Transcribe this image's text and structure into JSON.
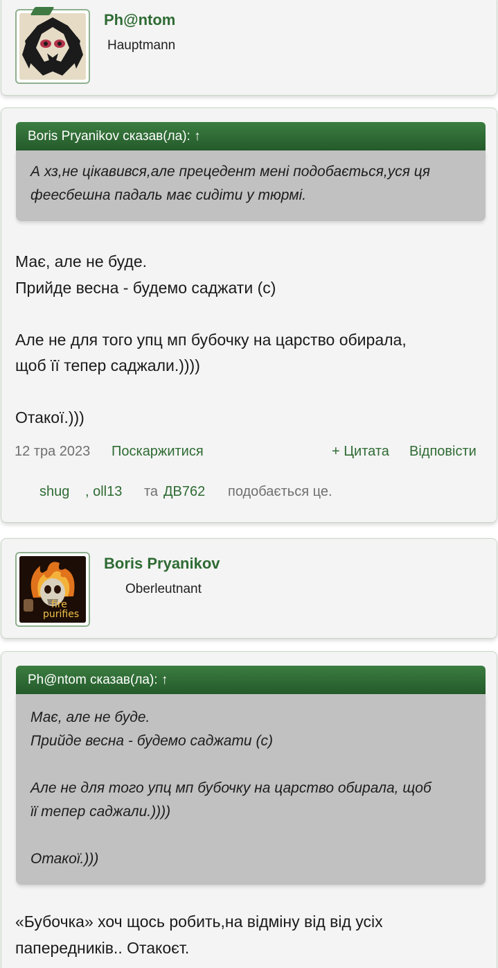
{
  "post1_user": {
    "name": "Ph@ntom",
    "rank": "Hauptmann",
    "avatar_icon": "tribal-mask-avatar"
  },
  "post1": {
    "quote_header": "Boris Pryanikov сказав(ла): ↑",
    "quote_lines": [
      "А хз,не цікавився,але прецедент мені подобається,уся ця",
      "феесбешна падаль має сидіти у тюрмі."
    ],
    "message_lines": [
      "Має, але не буде.",
      "Прийде весна - будемо саджати (с)",
      "",
      "Але не для того упц мп бубочку на царство обирала,",
      "щоб її тепер саджали.))))",
      "",
      "Отакої.)))"
    ],
    "date": "12 тра 2023",
    "report_label": "Поскаржитися",
    "quote_label": "+ Цитата",
    "reply_label": "Відповісти",
    "likes": {
      "user1": "shug",
      "user2": ", oll13",
      "and": "та",
      "user3": "ДВ762",
      "suffix": "подобається це."
    }
  },
  "post2_user": {
    "name": "Boris Pryanikov",
    "rank": "Oberleutnant",
    "avatar_icon": "flaming-skull-avatar",
    "avatar_caption_1": "fire",
    "avatar_caption_2": "purifies"
  },
  "post2": {
    "quote_header": "Ph@ntom сказав(ла): ↑",
    "quote_lines": [
      "Має, але не буде.",
      "Прийде весна - будемо саджати (с)",
      "",
      "Але не для того упц мп бубочку на царство обирала, щоб",
      "її тепер саджали.))))",
      "",
      "Отакої.)))"
    ],
    "message_lines": [
      "«Бубочка» хоч щось робить,на відміну від від усіх",
      "папередників.. Отакоєт."
    ]
  },
  "colors": {
    "accent_green": "#2e6b33",
    "quote_header_green": "#2f6e35",
    "quote_body_grey": "#c1c1c1",
    "card_bg": "#f4f4f4"
  }
}
